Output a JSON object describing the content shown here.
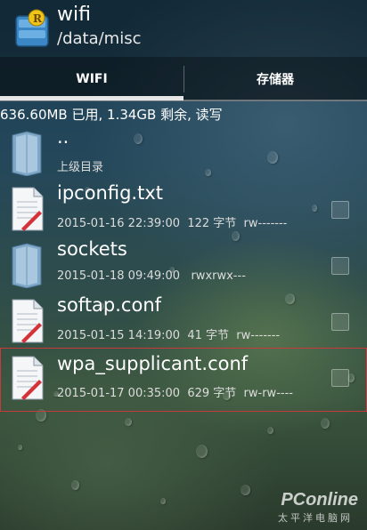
{
  "header": {
    "title": "wifi",
    "path": "/data/misc"
  },
  "tabs": [
    {
      "label": "WIFI",
      "active": true
    },
    {
      "label": "存储器",
      "active": false
    }
  ],
  "status_text": "636.60MB 已用, 1.34GB 剩余, 读写",
  "files": [
    {
      "name": "..",
      "meta": "上级目录",
      "type": "folder-icon"
    },
    {
      "name": "ipconfig.txt",
      "meta": "2015-01-16 22:39:00  122 字节  rw-------",
      "type": "document-icon"
    },
    {
      "name": "sockets",
      "meta": "2015-01-18 09:49:00   rwxrwx---",
      "type": "folder-icon"
    },
    {
      "name": "softap.conf",
      "meta": "2015-01-15 14:19:00  41 字节  rw-------",
      "type": "document-icon"
    },
    {
      "name": "wpa_supplicant.conf",
      "meta": "2015-01-17 00:35:00  629 字节  rw-rw----",
      "type": "document-icon"
    }
  ],
  "watermark": {
    "brand": "PConline",
    "sub": "太平洋电脑网"
  },
  "colors": {
    "accent_selection": "#c9383a",
    "tab_indicator": "#e6e6e6"
  }
}
